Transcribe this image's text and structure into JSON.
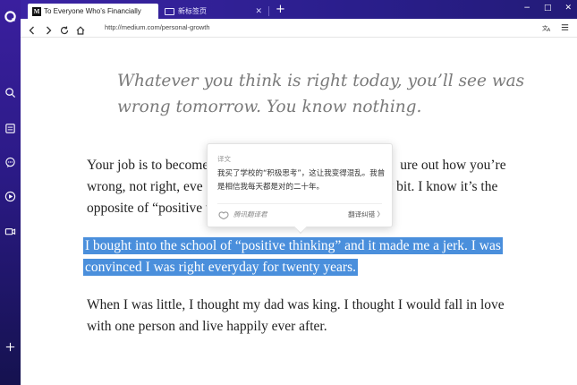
{
  "tabs": [
    {
      "label": "To Everyone Who’s Financially",
      "favicon": "M",
      "active": true
    },
    {
      "label": "新标签页",
      "favicon": "new-tab-page-icon",
      "active": false
    }
  ],
  "new_tab": "+",
  "window_controls": {
    "minimize": "−",
    "maximize": "□",
    "close": "✕"
  },
  "address_bar": {
    "url": "http://medium.com/personal-growth"
  },
  "sidebar": {
    "icons": [
      "app-logo-icon",
      "search-icon",
      "notes-icon",
      "chat-icon",
      "video-play-icon",
      "camera-icon",
      "plus-icon"
    ]
  },
  "article": {
    "quote": "Whatever you think is right today, you’ll see was wrong tomorrow. You know nothing.",
    "p1_line1_a": "Your job is to become",
    "p1_line1_b": "ure out how you’re",
    "p1_line2_a": "wrong, not right, eve",
    "p1_line2_b": "t by bit. I know it’s the",
    "p1_line3": "opposite of “positive t",
    "p2_line1": "I bought into the school of “positive thinking” and it made me a jerk. I was",
    "p2_line2": "convinced I was right everyday for twenty years.",
    "p3_line1": "When I was little, I thought my dad was king. I thought I would fall in love",
    "p3_line2": "with one person and live happily ever after."
  },
  "translation_popup": {
    "title": "译文",
    "text": "我买了学校的“积极思考”，这让我变得混乱。我曾是相信我每天都是对的二十年。",
    "brand": "腾讯翻译君",
    "report_label": "翻译纠错 〉"
  },
  "colors": {
    "sidebar": "#2b1a86",
    "highlight": "#4a8fdc",
    "quote_text": "#7a7a7a"
  }
}
